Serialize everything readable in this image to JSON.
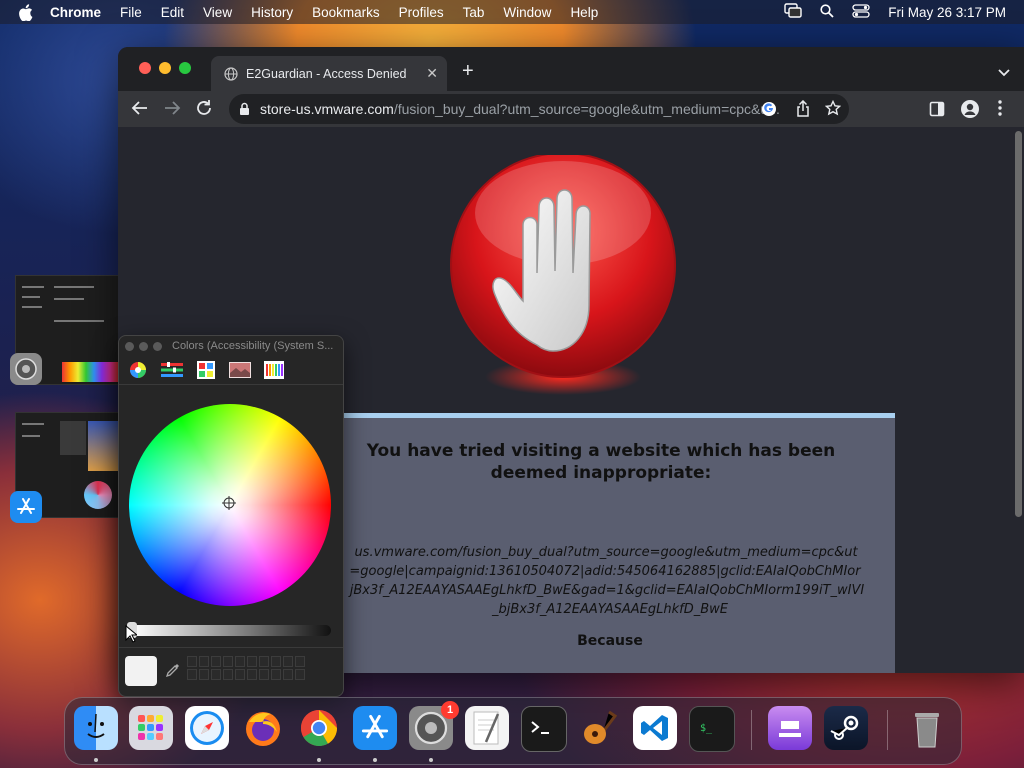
{
  "menubar": {
    "app_name": "Chrome",
    "items": [
      "File",
      "Edit",
      "View",
      "History",
      "Bookmarks",
      "Profiles",
      "Tab",
      "Window",
      "Help"
    ],
    "datetime": "Fri May 26  3:17 PM"
  },
  "browser": {
    "tab_title": "E2Guardian - Access Denied",
    "url_host": "store-us.vmware.com",
    "url_path": "/fusion_buy_dual?utm_source=google&utm_medium=cpc&u..."
  },
  "page": {
    "message": "You have tried visiting a website which has been deemed inappropriate:",
    "blocked_url_lines": [
      "us.vmware.com/fusion_buy_dual?utm_source=google&utm_medium=cpc&ut",
      "=google|campaignid:13610504072|adid:545064162885|gclid:EAIaIQobChMIor",
      "jBx3f_A12EAAYASAAEgLhkfD_BwE&gad=1&gclid=EAIaIQobChMIorm199iT_wIVI",
      "_bjBx3f_A12EAAYASAAEgLhkfD_BwE"
    ],
    "because_label": "Because"
  },
  "colors_panel": {
    "title": "Colors (Accessibility (System S..."
  },
  "dock": {
    "apps": [
      "Finder",
      "Launchpad",
      "Safari",
      "Firefox",
      "Google Chrome",
      "App Store",
      "System Preferences",
      "TextEdit",
      "Terminal",
      "GarageBand",
      "Visual Studio Code",
      "Script Editor",
      "Podcasts",
      "Steam",
      "Trash"
    ],
    "system_prefs_badge": "1"
  },
  "colors": {
    "accent_stop_red": "#e0201c",
    "panel_border": "#a9d0f0",
    "page_bg": "#25262e"
  }
}
